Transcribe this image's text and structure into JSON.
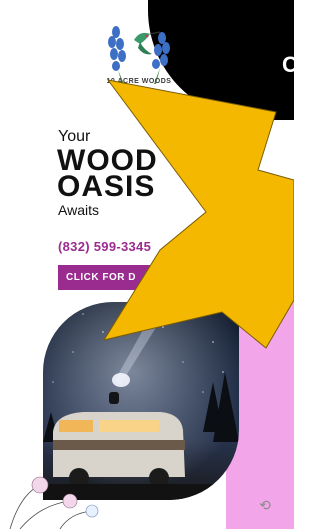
{
  "logo": {
    "text": "10 ACRE WOODS"
  },
  "hero": {
    "line1": "Your",
    "line2": "WOOD",
    "line3": "OASIS",
    "line4": "Awaits"
  },
  "contact": {
    "phone": "(832) 599-3345"
  },
  "cta": {
    "label": "CLICK FOR D"
  },
  "side": {
    "dark_text": "C"
  },
  "icons": {
    "reload": "reload-icon"
  },
  "colors": {
    "accent": "#9b2c8f",
    "arrow": "#f5b800",
    "pink": "#f3a5ea"
  }
}
